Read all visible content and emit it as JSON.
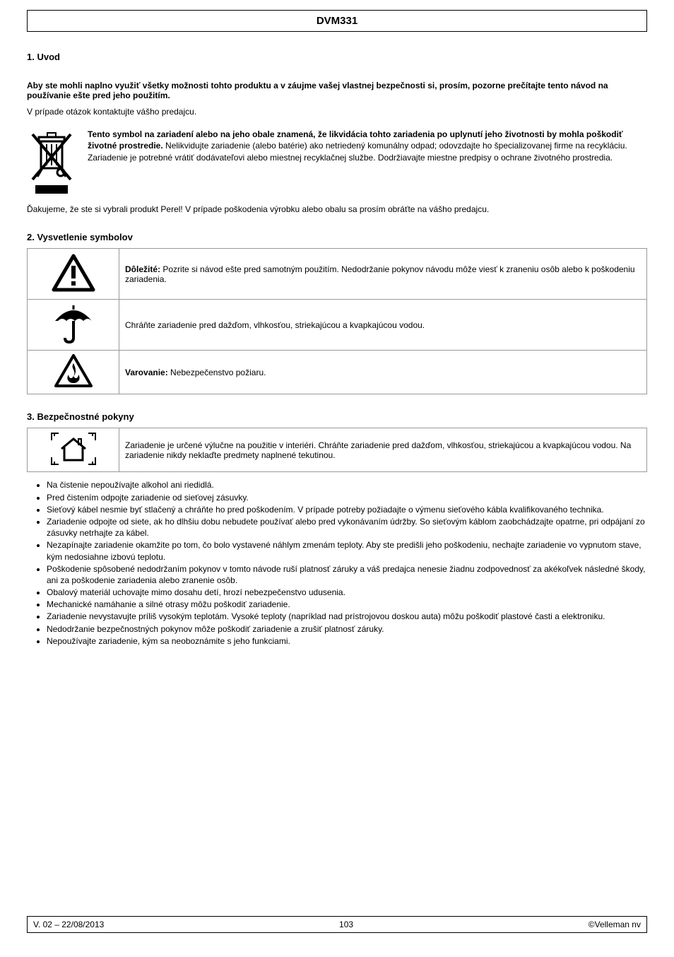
{
  "title": "DVM331",
  "intro_heading": "1. Uvod",
  "intro_bold": "Aby ste mohli naplno využiť všetky možnosti tohto produktu a v záujme vašej vlastnej bezpečnosti si, prosím, pozorne prečítajte tento návod na používanie ešte pred jeho použitím.",
  "intro_lines": "V prípade otázok kontaktujte vášho predajcu.",
  "weee": {
    "line1_bold_prefix": "Tento symbol na zariadení alebo na jeho obale znamená, že likvidácia tohto zariadenia po uplynutí jeho životnosti by mohla poškodiť životné prostredie.",
    "line1_rest": " Nelikvidujte zariadenie (alebo batérie) ako netriedený komunálny odpad; odovzdajte ho špecializovanej firme na recykláciu. Zariadenie je potrebné vrátiť dodávateľovi alebo miestnej recyklačnej službe. Dodržiavajte miestne predpisy o ochrane životného prostredia."
  },
  "thanks": "Ďakujeme, že ste si vybrali produkt Perel! V prípade poškodenia výrobku alebo obalu sa prosím obráťte na vášho predajcu.",
  "section2": "2. Vysvetlenie symbolov",
  "symrows": [
    {
      "text_bold": "Dôležité:",
      "text_rest": " Pozrite si návod ešte pred samotným použitím. Nedodržanie pokynov návodu môže viesť k zraneniu osôb alebo k poškodeniu zariadenia."
    },
    {
      "text_bold": "",
      "text_rest": "Chráňte zariadenie pred dažďom, vlhkosťou, striekajúcou a kvapkajúcou vodou."
    },
    {
      "text_bold": "Varovanie:",
      "text_rest": " Nebezpečenstvo požiaru."
    }
  ],
  "section3": "3. Bezpečnostné pokyny",
  "indoor_row": {
    "text": "Zariadenie je určené výlučne na použitie v interiéri. Chráňte zariadenie pred dažďom, vlhkosťou, striekajúcou a kvapkajúcou vodou. Na zariadenie nikdy neklaďte predmety naplnené tekutinou."
  },
  "bullets": [
    "Na čistenie nepoužívajte alkohol ani riedidlá.",
    "Pred čistením odpojte zariadenie od sieťovej zásuvky.",
    "Sieťový kábel nesmie byť stlačený a chráňte ho pred poškodením. V prípade potreby požiadajte o výmenu sieťového kábla kvalifikovaného technika.",
    "Zariadenie odpojte od siete, ak ho dlhšiu dobu nebudete používať alebo pred vykonávaním údržby. So sieťovým káblom zaobchádzajte opatrne, pri odpájaní zo zásuvky netrhajte za kábel.",
    "Nezapínajte zariadenie okamžite po tom, čo bolo vystavené náhlym zmenám teploty. Aby ste predišli jeho poškodeniu, nechajte zariadenie vo vypnutom stave, kým nedosiahne izbovú teplotu.",
    "Poškodenie spôsobené nedodržaním pokynov v tomto návode ruší platnosť záruky a váš predajca nenesie žiadnu zodpovednosť za akékoľvek následné škody, ani za poškodenie zariadenia alebo zranenie osôb.",
    "Obalový materiál uchovajte mimo dosahu detí, hrozí nebezpečenstvo udusenia.",
    "Mechanické namáhanie a silné otrasy môžu poškodiť zariadenie.",
    "Zariadenie nevystavujte príliš vysokým teplotám. Vysoké teploty (napríklad nad prístrojovou doskou auta) môžu poškodiť plastové časti a elektroniku.",
    "Nedodržanie bezpečnostných pokynov môže poškodiť zariadenie a zrušiť platnosť záruky.",
    "Nepoužívajte zariadenie, kým sa neoboznámite s jeho funkciami."
  ],
  "footer": {
    "left": "V. 02 – 22/08/2013",
    "center": "103",
    "right": "©Velleman nv"
  }
}
